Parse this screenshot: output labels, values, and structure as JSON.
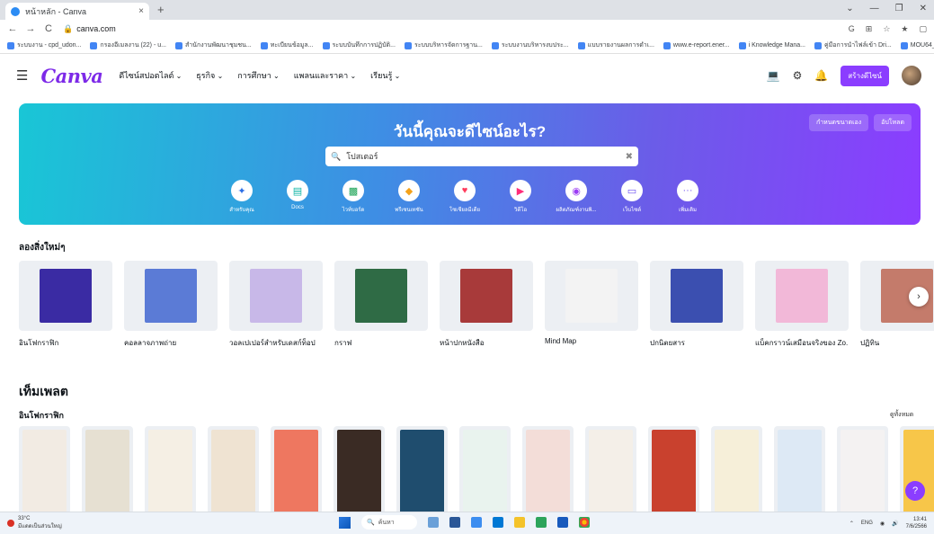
{
  "browser": {
    "tab_title": "หน้าหลัก - Canva",
    "tab_close": "×",
    "new_tab": "+",
    "url": "canva.com",
    "window_controls": [
      "⌄",
      "—",
      "❐",
      "✕"
    ],
    "nav": [
      "←",
      "→",
      "C"
    ],
    "address_right_icons": [
      "G",
      "⊞",
      "☆",
      "★",
      "▢"
    ],
    "bookmarks": [
      "ระบบงาน - cpd_udon...",
      "กรองอีเมลงาน (22) - u...",
      "สำนักงานพัฒนาชุมชน...",
      "ทะเบียนข้อมูล...",
      "ระบบบันทึกการปฏิบัติ...",
      "ระบบบริหารจัดการฐาน...",
      "ระบบงานบริหารงบประ...",
      "แบบรายงานผลการดำเ...",
      "www.e-report.ener...",
      "i Knowledge Mana...",
      "คู่มือการนำไฟล์เข้า Dri...",
      "MOU64_1 - Google..."
    ]
  },
  "header": {
    "logo": "Canva",
    "menu": [
      "ดีไซน์สปอตไลต์",
      "ธุรกิจ",
      "การศึกษา",
      "แพลนและราคา",
      "เรียนรู้"
    ],
    "create_button": "สร้างดีไซน์"
  },
  "hero": {
    "title": "วันนี้คุณจะดีไซน์อะไร?",
    "custom_size_button": "กำหนดขนาดเอง",
    "upload_button": "อัปโหลด",
    "search_value": "โปสเตอร์",
    "categories": [
      {
        "label": "สำหรับคุณ",
        "icon": "✦",
        "color": "#2b6ee5"
      },
      {
        "label": "Docs",
        "icon": "▤",
        "color": "#0fb5a6"
      },
      {
        "label": "ไวท์บอร์ด",
        "icon": "▩",
        "color": "#1aa356"
      },
      {
        "label": "พรีเซนเทชัน",
        "icon": "◆",
        "color": "#f4a21b"
      },
      {
        "label": "โซเชียลมีเดีย",
        "icon": "♥",
        "color": "#ff3b5c"
      },
      {
        "label": "วิดีโอ",
        "icon": "▶",
        "color": "#ff2d7a"
      },
      {
        "label": "ผลิตภัณฑ์งานพิ...",
        "icon": "◉",
        "color": "#9b3cf4"
      },
      {
        "label": "เว็บไซต์",
        "icon": "▭",
        "color": "#6a4cf0"
      },
      {
        "label": "เพิ่มเติม",
        "icon": "···",
        "color": "#7a5af0"
      }
    ]
  },
  "try_new": {
    "title": "ลองสิ่งใหม่ๆ",
    "items": [
      {
        "label": "อินโฟกราฟิก",
        "color": "#3a2ba3"
      },
      {
        "label": "คอลลาจภาพถ่าย",
        "color": "#5b7bd6"
      },
      {
        "label": "วอลเปเปอร์สำหรับเดสก์ท็อป",
        "color": "#c8b8e8"
      },
      {
        "label": "กราฟ",
        "color": "#2f6b45"
      },
      {
        "label": "หน้าปกหนังสือ",
        "color": "#a83a3a"
      },
      {
        "label": "Mind Map",
        "color": "#f3f3f3"
      },
      {
        "label": "ปกนิตยสาร",
        "color": "#3b4fb0"
      },
      {
        "label": "แบ็คกราวน์เสมือนจริงของ Zo...",
        "color": "#f2b8d8"
      },
      {
        "label": "ปฏิทิน",
        "color": "#c47b6b"
      }
    ],
    "next_arrow": "›"
  },
  "templates": {
    "heading": "เท็มเพลต",
    "subheading": "อินโฟกราฟิก",
    "see_all": "ดูทั้งหมด",
    "colors": [
      "#f2ebe3",
      "#e6e0d2",
      "#f5efe4",
      "#efe3d2",
      "#ee7760",
      "#3a2b24",
      "#1f4d6e",
      "#e9f3ee",
      "#f3ddd8",
      "#f4efe8",
      "#c9412e",
      "#f6efd9",
      "#dde9f5",
      "#f4f2f2",
      "#f7c649"
    ]
  },
  "help": "?",
  "taskbar": {
    "weather_temp": "33°C",
    "weather_desc": "มีแดดเป็นส่วนใหญ่",
    "search": "ค้นหา",
    "lang": "ENG",
    "time": "13:41",
    "date": "7/6/2566"
  }
}
